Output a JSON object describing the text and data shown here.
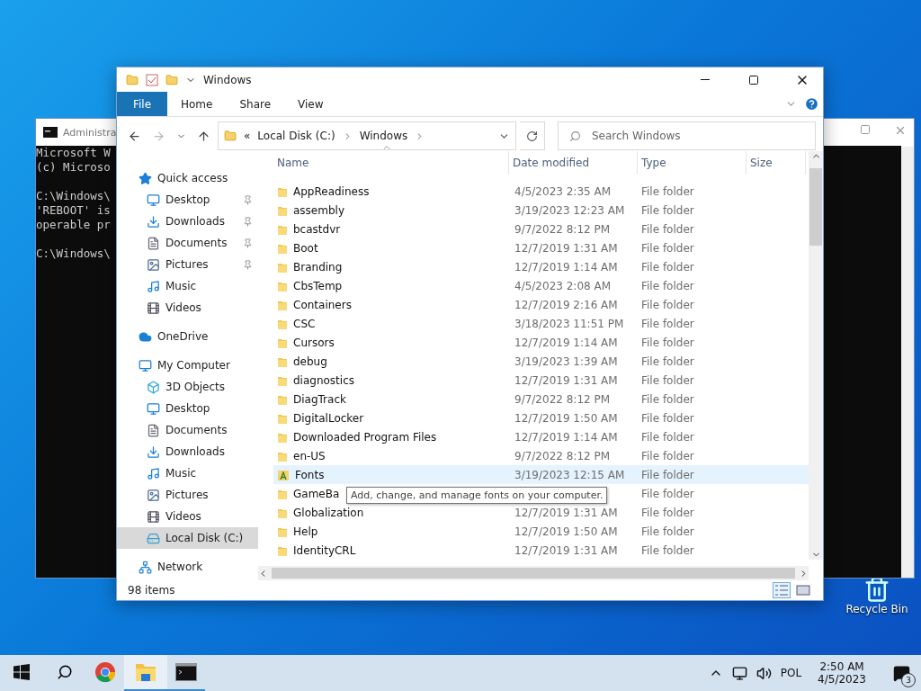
{
  "console_window": {
    "title": "Administra",
    "paragraphs": [
      [
        "Microsoft W",
        "(c) Microso"
      ],
      [
        "C:\\Windows\\",
        "'REBOOT' is",
        "operable pr"
      ],
      [
        "C:\\Windows\\"
      ]
    ]
  },
  "desktop_icons": [
    {
      "label": "Recycle Bin"
    }
  ],
  "explorer": {
    "title": "Windows",
    "ribbon_tabs": [
      {
        "label": "File",
        "selected": true
      },
      {
        "label": "Home",
        "selected": false
      },
      {
        "label": "Share",
        "selected": false
      },
      {
        "label": "View",
        "selected": false
      }
    ],
    "breadcrumb": [
      {
        "label": "«"
      },
      {
        "label": "Local Disk (C:)"
      },
      {
        "label": "Windows"
      }
    ],
    "search": {
      "placeholder": "Search Windows"
    },
    "sidebar": [
      {
        "label": "Quick access",
        "kind": "star",
        "selected": false,
        "children": [
          {
            "label": "Desktop",
            "kind": "desktop",
            "pinned": true,
            "selected": false
          },
          {
            "label": "Downloads",
            "kind": "downloads",
            "pinned": true,
            "selected": false
          },
          {
            "label": "Documents",
            "kind": "documents",
            "pinned": true,
            "selected": false
          },
          {
            "label": "Pictures",
            "kind": "pictures",
            "pinned": true,
            "selected": false
          },
          {
            "label": "Music",
            "kind": "music",
            "pinned": false,
            "selected": false
          },
          {
            "label": "Videos",
            "kind": "videos",
            "pinned": false,
            "selected": false
          }
        ]
      },
      {
        "label": "OneDrive",
        "kind": "cloud",
        "selected": false
      },
      {
        "label": "My Computer",
        "kind": "computer",
        "selected": false,
        "children": [
          {
            "label": "3D Objects",
            "kind": "objects",
            "pinned": false,
            "selected": false
          },
          {
            "label": "Desktop",
            "kind": "desktop",
            "pinned": false,
            "selected": false
          },
          {
            "label": "Documents",
            "kind": "documents",
            "pinned": false,
            "selected": false
          },
          {
            "label": "Downloads",
            "kind": "downloads",
            "pinned": false,
            "selected": false
          },
          {
            "label": "Music",
            "kind": "music",
            "pinned": false,
            "selected": false
          },
          {
            "label": "Pictures",
            "kind": "pictures",
            "pinned": false,
            "selected": false
          },
          {
            "label": "Videos",
            "kind": "videos",
            "pinned": false,
            "selected": false
          },
          {
            "label": "Local Disk (C:)",
            "kind": "disk",
            "pinned": false,
            "selected": true
          }
        ]
      },
      {
        "label": "Network",
        "kind": "network",
        "selected": false
      }
    ],
    "columns": [
      "Name",
      "Date modified",
      "Type",
      "Size"
    ],
    "rows": [
      {
        "kind": "folder",
        "name": "AppReadiness",
        "date": "4/5/2023 2:35 AM",
        "type": "File folder",
        "hovered": false
      },
      {
        "kind": "folder",
        "name": "assembly",
        "date": "3/19/2023 12:23 AM",
        "type": "File folder",
        "hovered": false
      },
      {
        "kind": "folder",
        "name": "bcastdvr",
        "date": "9/7/2022 8:12 PM",
        "type": "File folder",
        "hovered": false
      },
      {
        "kind": "folder",
        "name": "Boot",
        "date": "12/7/2019 1:31 AM",
        "type": "File folder",
        "hovered": false
      },
      {
        "kind": "folder",
        "name": "Branding",
        "date": "12/7/2019 1:14 AM",
        "type": "File folder",
        "hovered": false
      },
      {
        "kind": "folder",
        "name": "CbsTemp",
        "date": "4/5/2023 2:08 AM",
        "type": "File folder",
        "hovered": false
      },
      {
        "kind": "folder",
        "name": "Containers",
        "date": "12/7/2019 2:16 AM",
        "type": "File folder",
        "hovered": false
      },
      {
        "kind": "folder",
        "name": "CSC",
        "date": "3/18/2023 11:51 PM",
        "type": "File folder",
        "hovered": false
      },
      {
        "kind": "folder",
        "name": "Cursors",
        "date": "12/7/2019 1:14 AM",
        "type": "File folder",
        "hovered": false
      },
      {
        "kind": "folder",
        "name": "debug",
        "date": "3/19/2023 1:39 AM",
        "type": "File folder",
        "hovered": false
      },
      {
        "kind": "folder",
        "name": "diagnostics",
        "date": "12/7/2019 1:31 AM",
        "type": "File folder",
        "hovered": false
      },
      {
        "kind": "folder",
        "name": "DiagTrack",
        "date": "9/7/2022 8:12 PM",
        "type": "File folder",
        "hovered": false
      },
      {
        "kind": "folder",
        "name": "DigitalLocker",
        "date": "12/7/2019 1:50 AM",
        "type": "File folder",
        "hovered": false
      },
      {
        "kind": "folder",
        "name": "Downloaded Program Files",
        "date": "12/7/2019 1:14 AM",
        "type": "File folder",
        "hovered": false
      },
      {
        "kind": "folder",
        "name": "en-US",
        "date": "9/7/2022 8:12 PM",
        "type": "File folder",
        "hovered": false
      },
      {
        "kind": "fonts",
        "name": "Fonts",
        "date": "3/19/2023 12:15 AM",
        "type": "File folder",
        "hovered": true
      },
      {
        "kind": "folder",
        "name": "GameBa",
        "type": "File folder",
        "hovered": false
      },
      {
        "kind": "folder",
        "name": "Globalization",
        "date": "12/7/2019 1:31 AM",
        "type": "File folder",
        "hovered": false
      },
      {
        "kind": "folder",
        "name": "Help",
        "date": "12/7/2019 1:50 AM",
        "type": "File folder",
        "hovered": false
      },
      {
        "kind": "folder",
        "name": "IdentityCRL",
        "date": "12/7/2019 1:31 AM",
        "type": "File folder",
        "hovered": false
      }
    ],
    "tooltip": "Add, change, and manage fonts on your computer.",
    "status": "98 items"
  },
  "taskbar": {
    "apps": [
      {
        "kind": "chrome",
        "active": false,
        "running": false
      },
      {
        "kind": "explorer",
        "active": true,
        "running": true
      },
      {
        "kind": "console",
        "active": false,
        "running": true
      }
    ],
    "language": "POL",
    "time": "2:50 AM",
    "date": "4/5/2023",
    "notifications": "3"
  }
}
